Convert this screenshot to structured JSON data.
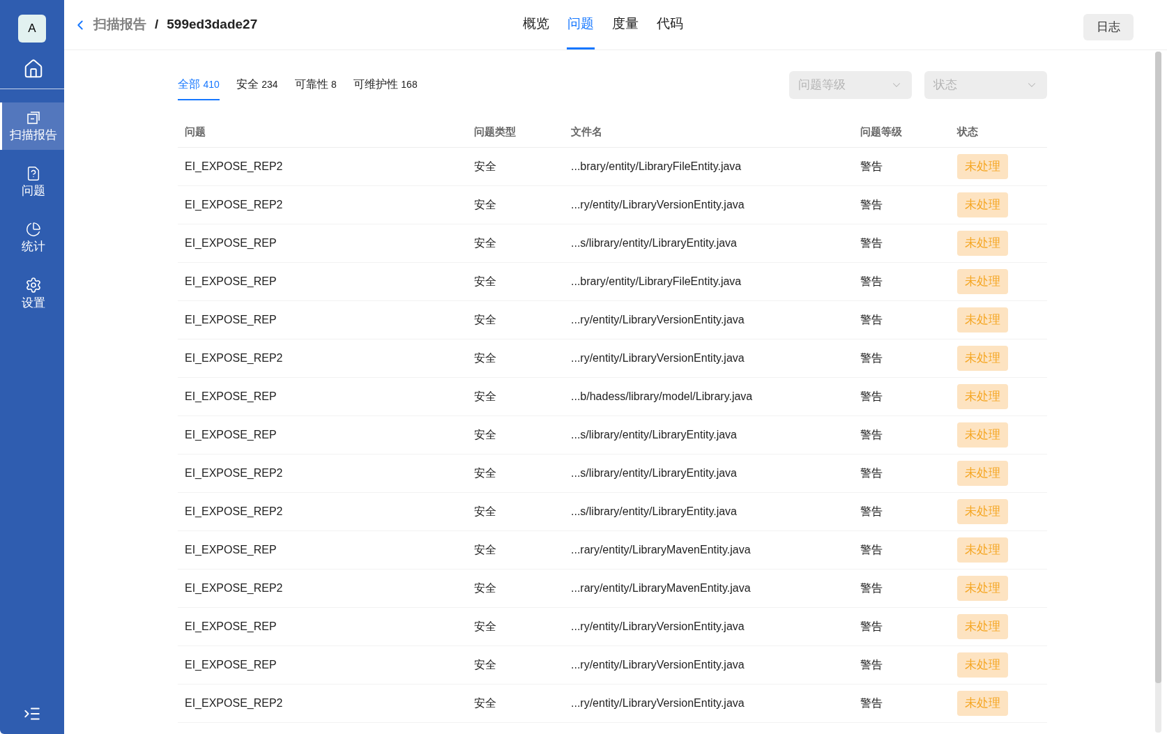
{
  "sidebar": {
    "avatar": "A",
    "items": [
      {
        "kind": "home",
        "selected": false
      },
      {
        "kind": "scan",
        "label": "扫描报告",
        "selected": true
      },
      {
        "kind": "issue",
        "label": "问题",
        "selected": false
      },
      {
        "kind": "stats",
        "label": "统计",
        "selected": false
      },
      {
        "kind": "settings",
        "label": "设置",
        "selected": false
      }
    ]
  },
  "header": {
    "back": "扫描报告",
    "separator": "/",
    "title": "599ed3dade27",
    "tabs": [
      {
        "label": "概览",
        "selected": false
      },
      {
        "label": "问题",
        "selected": true
      },
      {
        "label": "度量",
        "selected": false
      },
      {
        "label": "代码",
        "selected": false
      }
    ],
    "log_button": "日志"
  },
  "filters": {
    "tabs": [
      {
        "label": "全部",
        "count": "410",
        "selected": true
      },
      {
        "label": "安全",
        "count": "234",
        "selected": false
      },
      {
        "label": "可靠性",
        "count": "8",
        "selected": false
      },
      {
        "label": "可维护性",
        "count": "168",
        "selected": false
      }
    ],
    "selects": [
      {
        "placeholder": "问题等级"
      },
      {
        "placeholder": "状态"
      }
    ]
  },
  "table": {
    "columns": [
      "问题",
      "问题类型",
      "文件名",
      "问题等级",
      "状态"
    ],
    "rows": [
      {
        "issue": "EI_EXPOSE_REP2",
        "type": "安全",
        "file": "...brary/entity/LibraryFileEntity.java",
        "level": "警告",
        "status": "未处理"
      },
      {
        "issue": "EI_EXPOSE_REP2",
        "type": "安全",
        "file": "...ry/entity/LibraryVersionEntity.java",
        "level": "警告",
        "status": "未处理"
      },
      {
        "issue": "EI_EXPOSE_REP",
        "type": "安全",
        "file": "...s/library/entity/LibraryEntity.java",
        "level": "警告",
        "status": "未处理"
      },
      {
        "issue": "EI_EXPOSE_REP",
        "type": "安全",
        "file": "...brary/entity/LibraryFileEntity.java",
        "level": "警告",
        "status": "未处理"
      },
      {
        "issue": "EI_EXPOSE_REP",
        "type": "安全",
        "file": "...ry/entity/LibraryVersionEntity.java",
        "level": "警告",
        "status": "未处理"
      },
      {
        "issue": "EI_EXPOSE_REP2",
        "type": "安全",
        "file": "...ry/entity/LibraryVersionEntity.java",
        "level": "警告",
        "status": "未处理"
      },
      {
        "issue": "EI_EXPOSE_REP",
        "type": "安全",
        "file": "...b/hadess/library/model/Library.java",
        "level": "警告",
        "status": "未处理"
      },
      {
        "issue": "EI_EXPOSE_REP",
        "type": "安全",
        "file": "...s/library/entity/LibraryEntity.java",
        "level": "警告",
        "status": "未处理"
      },
      {
        "issue": "EI_EXPOSE_REP2",
        "type": "安全",
        "file": "...s/library/entity/LibraryEntity.java",
        "level": "警告",
        "status": "未处理"
      },
      {
        "issue": "EI_EXPOSE_REP2",
        "type": "安全",
        "file": "...s/library/entity/LibraryEntity.java",
        "level": "警告",
        "status": "未处理"
      },
      {
        "issue": "EI_EXPOSE_REP",
        "type": "安全",
        "file": "...rary/entity/LibraryMavenEntity.java",
        "level": "警告",
        "status": "未处理"
      },
      {
        "issue": "EI_EXPOSE_REP2",
        "type": "安全",
        "file": "...rary/entity/LibraryMavenEntity.java",
        "level": "警告",
        "status": "未处理"
      },
      {
        "issue": "EI_EXPOSE_REP",
        "type": "安全",
        "file": "...ry/entity/LibraryVersionEntity.java",
        "level": "警告",
        "status": "未处理"
      },
      {
        "issue": "EI_EXPOSE_REP",
        "type": "安全",
        "file": "...ry/entity/LibraryVersionEntity.java",
        "level": "警告",
        "status": "未处理"
      },
      {
        "issue": "EI_EXPOSE_REP2",
        "type": "安全",
        "file": "...ry/entity/LibraryVersionEntity.java",
        "level": "警告",
        "status": "未处理"
      }
    ]
  }
}
